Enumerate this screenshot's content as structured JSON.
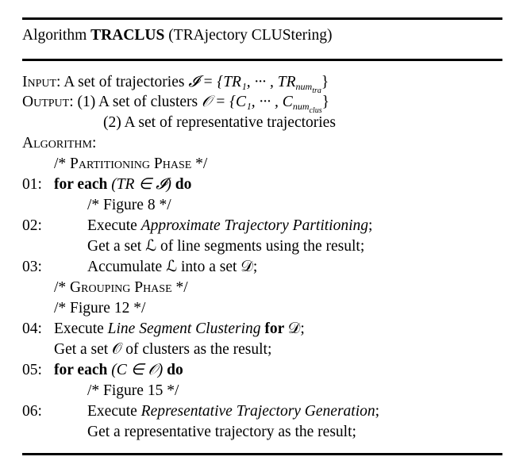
{
  "algorithm": {
    "prefix": "Algorithm",
    "name": "TRACLUS",
    "subtitle": "(TRAjectory CLUStering)"
  },
  "io": {
    "input_label": "Input:",
    "input_text": "A set of trajectories",
    "input_math": "𝓘 = {TR₁, ··· , TR",
    "input_sub": "num",
    "input_subsub": "tra",
    "output_label": "Output:",
    "output_1": "(1) A set of clusters",
    "output_1_math": "𝒪 = {C₁, ··· , C",
    "output_1_sub": "num",
    "output_1_subsub": "clus",
    "output_2": "(2) A set of representative trajectories",
    "algorithm_label": "Algorithm:"
  },
  "lines": [
    {
      "num": "",
      "text": "/* Partitioning Phase */"
    },
    {
      "num": "01:",
      "kw": "for each",
      "math": "(TR ∈ 𝓘)",
      "kw2": "do"
    },
    {
      "num": "",
      "text": "/* Figure 8 */"
    },
    {
      "num": "02:",
      "pre": "Execute ",
      "it": "Approximate Trajectory Partitioning",
      "post": ";"
    },
    {
      "num": "",
      "text": "Get a set ℒ of line segments using the result;"
    },
    {
      "num": "03:",
      "text": "Accumulate ℒ into a set 𝒟;"
    },
    {
      "num": "",
      "text": "/* Grouping Phase */"
    },
    {
      "num": "",
      "text": "/* Figure 12 */"
    },
    {
      "num": "04:",
      "pre": "Execute ",
      "it": "Line Segment Clustering",
      "kw": " for ",
      "post": "𝒟;"
    },
    {
      "num": "",
      "text": "Get a set 𝒪 of clusters as the result;"
    },
    {
      "num": "05:",
      "kw": "for each",
      "math": "(C ∈ 𝒪)",
      "kw2": "do"
    },
    {
      "num": "",
      "text": "/* Figure 15 */"
    },
    {
      "num": "06:",
      "pre": "Execute ",
      "it": "Representative Trajectory Generation",
      "post": ";"
    },
    {
      "num": "",
      "text": "Get a representative trajectory as the result;"
    }
  ]
}
